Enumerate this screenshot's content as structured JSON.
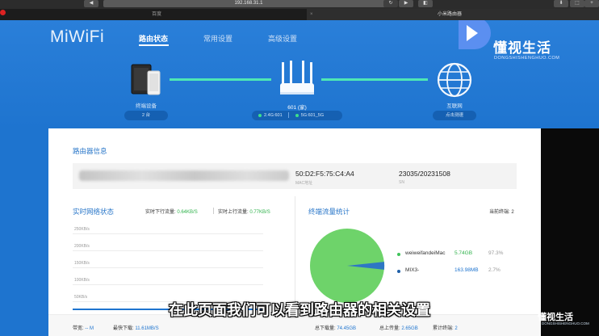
{
  "browser": {
    "url": "192.168.31.1",
    "tab_left": "百度",
    "tab_right": "小米路由器"
  },
  "router_app": {
    "logo": "MiWiFi",
    "nav": [
      "路由状态",
      "常用设置",
      "高级设置"
    ],
    "devices": {
      "label": "终端设备",
      "count": "2 台"
    },
    "router": {
      "name": "601 (家)",
      "wifi_24": "2.4G:601",
      "wifi_5g": "5G:601_5G"
    },
    "internet": {
      "label": "互联网",
      "speedtest": "点击测速"
    }
  },
  "router_info": {
    "title": "路由器信息",
    "mac": "50:D2:F5:75:C4:A4",
    "mac_label": "MAC地址",
    "sn": "23035/20231508",
    "sn_label": "SN"
  },
  "network_status": {
    "title": "实时网络状态",
    "down_label": "实时下行流量:",
    "down_value": "0.64KB/S",
    "up_label": "实时上行流量:",
    "up_value": "0.77KB/S",
    "ticks": [
      "250KB/s",
      "200KB/s",
      "150KB/s",
      "100KB/s",
      "50KB/s"
    ],
    "bandwidth_label": "带宽:",
    "bandwidth_value": "-- M",
    "fastest_label": "最快下载:",
    "fastest_value": "11.61MB/S"
  },
  "traffic": {
    "title": "终端流量统计",
    "current_label": "当前终端:",
    "current_value": "2",
    "items": [
      {
        "name": "weiweifandeiMac",
        "value": "5.74GB",
        "pct": "97.3%",
        "color": "#3fc35a"
      },
      {
        "name": "MIX3-",
        "value": "163.98MB",
        "pct": "2.7%",
        "color": "#1f5fa8"
      }
    ],
    "total_down_label": "总下载量:",
    "total_down_value": "74.45GB",
    "total_up_label": "总上传量:",
    "total_up_value": "2.65GB",
    "cumulative_label": "累计终端:",
    "cumulative_value": "2"
  },
  "overlay": {
    "subtitle": "在此页面我们可以看到路由器的相关设置",
    "watermark": "懂视生活",
    "watermark_sub": "DONGSHISHENGHUO.COM"
  },
  "colors": {
    "page_blue": "#1e74cf",
    "accent_green": "#2fb24b",
    "link_line": "#4ee8b4"
  }
}
